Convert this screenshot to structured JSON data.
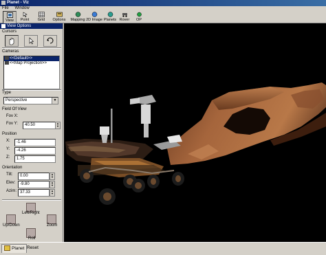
{
  "window": {
    "title": "Planet - Viz"
  },
  "menu": [
    "File",
    "Window"
  ],
  "toolbar": [
    {
      "label": "View",
      "icon": "view-icon"
    },
    {
      "label": "Point",
      "icon": "point-icon"
    },
    {
      "label": "Grid",
      "icon": "grid-icon"
    },
    {
      "label": "Options",
      "icon": "options-icon"
    },
    {
      "label": "Mapping",
      "icon": "mapping-icon"
    },
    {
      "label": "2D Image",
      "icon": "image-2d-icon"
    },
    {
      "label": "Planets",
      "icon": "planets-icon"
    },
    {
      "label": "Rover",
      "icon": "rover-icon"
    },
    {
      "label": "OP",
      "icon": "op-icon"
    }
  ],
  "panel": {
    "title": "View Options",
    "cursors_label": "Cursors",
    "cameras_label": "Cameras",
    "cameras": [
      "<<Default>>",
      "<<Map Projection>>"
    ],
    "type_label": "Type",
    "type_value": "Perspective",
    "fov_label": "Field Of View",
    "fov_x_label": "Fov X:",
    "fov_y_label": "Fov Y:",
    "fov_y_value": "40.50",
    "position_label": "Position",
    "pos_x_label": "X:",
    "pos_x": "-1.46",
    "pos_y_label": "Y:",
    "pos_y": "-4.26",
    "pos_z_label": "Z:",
    "pos_z": "1.75",
    "orientation_label": "Orientation",
    "tilt_label": "Tilt:",
    "tilt": "0.00",
    "elev_label": "Elev:",
    "elev": "-9.80",
    "azim_label": "Azim:",
    "azim": "37.33"
  },
  "nav": {
    "left_right": "Left/Right",
    "up_down": "Up/Down",
    "zoom": "Zoom",
    "roll": "Roll"
  },
  "tabs": {
    "planet": "Planet",
    "reset": "Reset"
  },
  "colors": {
    "title_bar": "#0a246a",
    "terrain": "#a0623a",
    "viewport_bg": "#000000"
  }
}
